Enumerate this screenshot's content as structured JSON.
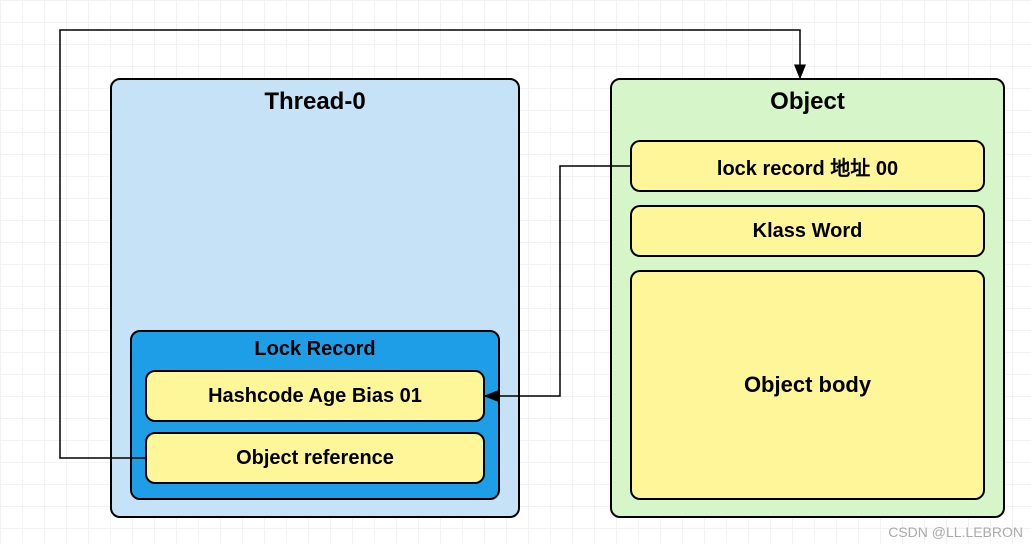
{
  "thread": {
    "title": "Thread-0",
    "lock_record": {
      "title": "Lock Record",
      "mark_word": "Hashcode Age Bias 01",
      "object_ref": "Object reference"
    }
  },
  "object": {
    "title": "Object",
    "mark_word": "lock record 地址 00",
    "klass_word": "Klass Word",
    "body": "Object body"
  },
  "arrows": [
    {
      "from": "thread.lock_record.object_ref",
      "to": "object",
      "path": "left-up-right-down"
    },
    {
      "from": "object.mark_word",
      "to": "thread.lock_record.mark_word",
      "path": "left-down-left"
    }
  ],
  "attribution": "CSDN @LL.LEBRON"
}
